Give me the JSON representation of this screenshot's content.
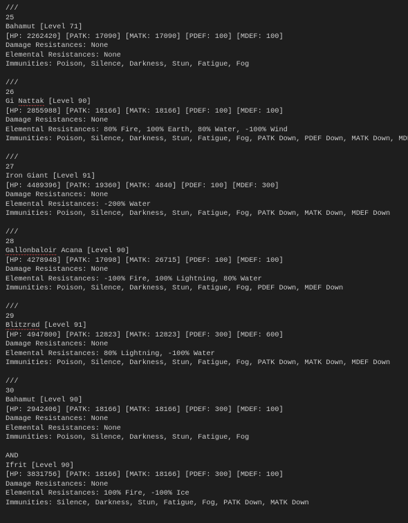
{
  "entries": [
    {
      "divider": "///",
      "index": "25",
      "name_plain": "Bahamut",
      "name_squiggle": "",
      "name_tail": "",
      "level": "71",
      "stats": {
        "hp": "2262420",
        "patk": "17090",
        "matk": "17090",
        "pdef": "100",
        "mdef": "100"
      },
      "dmg_res": "None",
      "elem_res": "None",
      "immunities": "Poison, Silence, Darkness, Stun, Fatigue, Fog",
      "and_after": false
    },
    {
      "divider": "///",
      "index": "26",
      "name_plain": "Gi ",
      "name_squiggle": "Nattak",
      "name_tail": "",
      "level": "90",
      "stats": {
        "hp": "2855988",
        "patk": "18166",
        "matk": "18166",
        "pdef": "100",
        "mdef": "100"
      },
      "dmg_res": "None",
      "elem_res": "80% Fire, 100% Earth, 80% Water, -100% Wind",
      "immunities": "Poison, Silence, Darkness, Stun, Fatigue, Fog, PATK Down, PDEF Down, MATK Down, MDEF Down",
      "and_after": false
    },
    {
      "divider": "///",
      "index": "27",
      "name_plain": "Iron Giant",
      "name_squiggle": "",
      "name_tail": "",
      "level": "91",
      "stats": {
        "hp": "4489396",
        "patk": "19360",
        "matk": "4840",
        "pdef": "100",
        "mdef": "300"
      },
      "dmg_res": "None",
      "elem_res": "-200% Water",
      "immunities": "Poison, Silence, Darkness, Stun, Fatigue, Fog, PATK Down, MATK Down, MDEF Down",
      "and_after": false
    },
    {
      "divider": "///",
      "index": "28",
      "name_plain": "",
      "name_squiggle": "Gallonbaloir",
      "name_tail": " Acana",
      "level": "90",
      "stats": {
        "hp": "4278948",
        "patk": "17098",
        "matk": "26715",
        "pdef": "100",
        "mdef": "100"
      },
      "dmg_res": "None",
      "elem_res": "-100% Fire, 100% Lightning, 80% Water",
      "immunities": "Poison, Silence, Darkness, Stun, Fatigue, Fog, PDEF Down, MDEF Down",
      "and_after": false
    },
    {
      "divider": "///",
      "index": "29",
      "name_plain": "",
      "name_squiggle": "Blitzrad",
      "name_tail": "",
      "level": "91",
      "stats": {
        "hp": "4947800",
        "patk": "12823",
        "matk": "12823",
        "pdef": "300",
        "mdef": "600"
      },
      "dmg_res": "None",
      "elem_res": "80% Lightning, -100% Water",
      "immunities": "Poison, Silence, Darkness, Stun, Fatigue, Fog, PATK Down, MATK Down, MDEF Down",
      "and_after": false
    },
    {
      "divider": "///",
      "index": "30",
      "name_plain": "Bahamut",
      "name_squiggle": "",
      "name_tail": "",
      "level": "90",
      "stats": {
        "hp": "2942406",
        "patk": "18166",
        "matk": "18166",
        "pdef": "300",
        "mdef": "100"
      },
      "dmg_res": "None",
      "elem_res": "None",
      "immunities": "Poison, Silence, Darkness, Stun, Fatigue, Fog",
      "and_after": true
    },
    {
      "divider": "",
      "index": "",
      "name_plain": "Ifrit",
      "name_squiggle": "",
      "name_tail": "",
      "level": "90",
      "stats": {
        "hp": "3831756",
        "patk": "18166",
        "matk": "18166",
        "pdef": "300",
        "mdef": "100"
      },
      "dmg_res": "None",
      "elem_res": "100% Fire, -100% Ice",
      "immunities": "Silence, Darkness, Stun, Fatigue, Fog, PATK Down, MATK Down",
      "and_after": false
    }
  ],
  "labels": {
    "hp": "HP",
    "patk": "PATK",
    "matk": "MATK",
    "pdef": "PDEF",
    "mdef": "MDEF",
    "level_prefix": "Level",
    "damage": "Damage Resistances",
    "elemental": "Elemental Resistances",
    "immunities": "Immunities",
    "and": "AND"
  }
}
